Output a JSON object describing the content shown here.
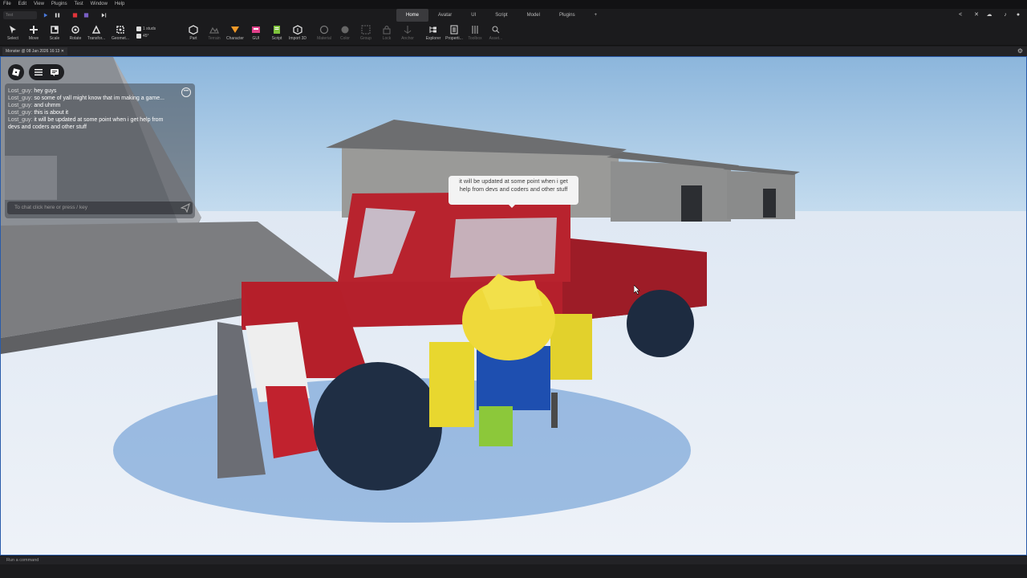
{
  "menu": [
    "File",
    "Edit",
    "View",
    "Plugins",
    "Test",
    "Window",
    "Help"
  ],
  "play_mode": "Test",
  "tabs": [
    {
      "label": "Home",
      "active": true
    },
    {
      "label": "Avatar",
      "active": false
    },
    {
      "label": "UI",
      "active": false
    },
    {
      "label": "Script",
      "active": false
    },
    {
      "label": "Model",
      "active": false
    },
    {
      "label": "Plugins",
      "active": false
    },
    {
      "label": "+",
      "active": false
    }
  ],
  "toolbar": {
    "select": "Select",
    "move": "Move",
    "scale": "Scale",
    "rotate": "Rotate",
    "transform": "Transfor...",
    "geometry": "Geomet...",
    "studs": "1 studs",
    "angle": "45°",
    "part": "Part",
    "terrain": "Terrain",
    "character": "Character",
    "gui": "GUI",
    "script": "Script",
    "import3d": "Import 3D",
    "material": "Material",
    "color": "Color",
    "group": "Group",
    "lock": "Lock",
    "anchor": "Anchor",
    "explorer": "Explorer",
    "properties": "Properti...",
    "toolbox": "Toolbox",
    "assets": "Asset..."
  },
  "document_tab": "Monster @ 08 Jan 2026 16:13",
  "chat": {
    "lines": [
      {
        "name": "Lost_guy:",
        "text": "hey guys"
      },
      {
        "name": "Lost_guy:",
        "text": "so some of yall might know that im making a game..."
      },
      {
        "name": "Lost_guy:",
        "text": "and uhmm"
      },
      {
        "name": "Lost_guy:",
        "text": "this is about it"
      },
      {
        "name": "Lost_guy:",
        "text": "it will be updated at some point when i get help from devs and coders and other stuff"
      }
    ],
    "input_placeholder": "To chat click here or press / key"
  },
  "bubble_text": "it will be updated at some point when i get help from devs and coders and other stuff",
  "command_placeholder": "Run a command",
  "colors": {
    "accent": "#2a5caa",
    "truck_red": "#b5202c",
    "character_yellow": "#e8d72f",
    "torso_blue": "#1e4fb0"
  }
}
